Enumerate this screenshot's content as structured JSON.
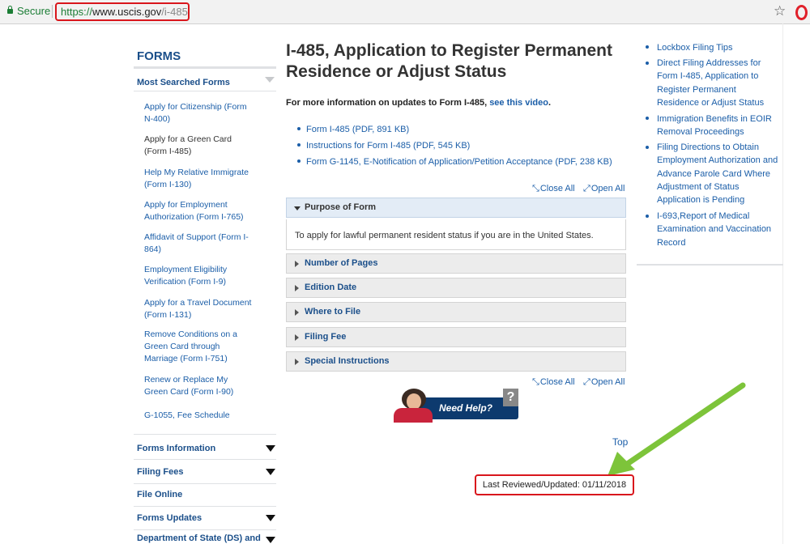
{
  "browser": {
    "secure_label": "Secure",
    "url_proto": "https://",
    "url_host": "www.uscis.gov",
    "url_path": "/i-485"
  },
  "sidebar": {
    "title": "FORMS",
    "most_searched_label": "Most Searched Forms",
    "links": [
      {
        "label": "Apply for Citizenship (Form N-400)",
        "current": false
      },
      {
        "label": "Apply for a Green Card (Form I-485)",
        "current": true
      },
      {
        "label": "Help My Relative Immigrate (Form I-130)",
        "current": false
      },
      {
        "label": "Apply for Employment Authorization (Form I-765)",
        "current": false
      },
      {
        "label": "Affidavit of Support (Form I-864)",
        "current": false
      },
      {
        "label": "Employment Eligibility Verification (Form I-9)",
        "current": false
      },
      {
        "label": "Apply for a Travel Document (Form I-131)",
        "current": false
      },
      {
        "label": "Remove Conditions on a Green Card through Marriage (Form I-751)",
        "current": false
      },
      {
        "label": "Renew or Replace My Green Card (Form I-90)",
        "current": false
      },
      {
        "label": "G-1055, Fee Schedule",
        "current": false
      }
    ],
    "sections": [
      {
        "label": "Forms Information",
        "expandable": true
      },
      {
        "label": "Filing Fees",
        "expandable": true
      },
      {
        "label": "File Online",
        "expandable": false
      },
      {
        "label": "Forms Updates",
        "expandable": true
      },
      {
        "label": "Department of State (DS) and",
        "expandable": true
      }
    ]
  },
  "main": {
    "title": "I-485, Application to Register Permanent Residence or Adjust Status",
    "more_info_text": "For more information on updates to Form I-485, ",
    "more_info_link": "see this video",
    "more_info_end": ".",
    "documents": [
      "Form I-485 (PDF, 891 KB)",
      "Instructions for Form I-485 (PDF, 545 KB)",
      "Form G-1145, E-Notification of Application/Petition Acceptance (PDF, 238 KB)"
    ],
    "close_all": "Close All",
    "open_all": "Open All",
    "accordion": [
      {
        "label": "Purpose of Form",
        "open": true,
        "body": "To apply for lawful permanent resident status if you are in the United States."
      },
      {
        "label": "Number of Pages",
        "open": false
      },
      {
        "label": "Edition Date",
        "open": false
      },
      {
        "label": "Where to File",
        "open": false
      },
      {
        "label": "Filing Fee",
        "open": false
      },
      {
        "label": "Special Instructions",
        "open": false
      }
    ],
    "need_help_label": "Need Help?",
    "top_label": "Top",
    "last_reviewed": "Last Reviewed/Updated: 01/11/2018"
  },
  "right": {
    "links": [
      "Lockbox Filing Tips",
      "Direct Filing Addresses for Form I-485, Application to Register Permanent Residence or Adjust Status",
      "Immigration Benefits in EOIR Removal Proceedings",
      "Filing Directions to Obtain Employment Authorization and Advance Parole Card Where Adjustment of Status Application is Pending",
      "I-693,Report of Medical Examination and Vaccination Record"
    ]
  },
  "colors": {
    "link": "#1b5ea8",
    "heading_blue": "#1b4f8a",
    "highlight_red": "#d9161c",
    "arrow_green": "#7dc43a"
  }
}
